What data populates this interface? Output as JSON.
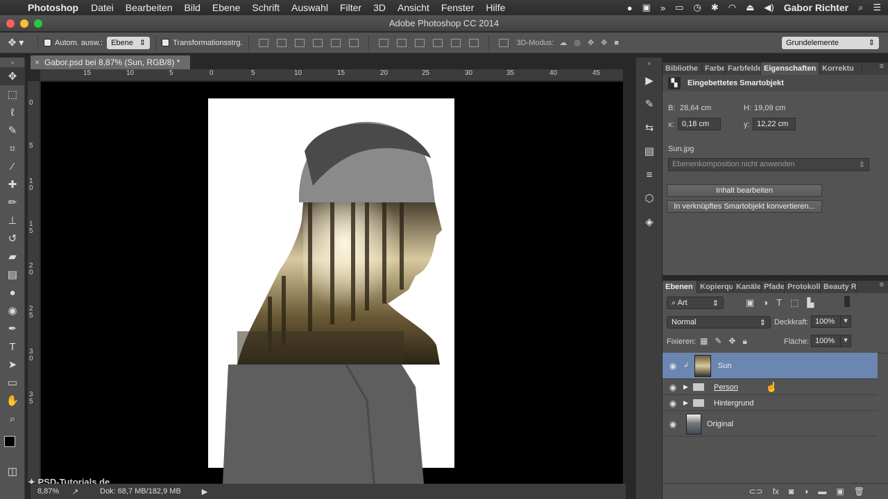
{
  "menubar": {
    "app": "Photoshop",
    "items": [
      "Datei",
      "Bearbeiten",
      "Bild",
      "Ebene",
      "Schrift",
      "Auswahl",
      "Filter",
      "3D",
      "Ansicht",
      "Fenster",
      "Hilfe"
    ],
    "user": "Gabor Richter"
  },
  "window_title": "Adobe Photoshop CC 2014",
  "options": {
    "auto_select_label": "Autom. ausw.:",
    "auto_select_value": "Ebene",
    "transform_label": "Transformationsstrg.",
    "mode_3d_label": "3D-Modus:",
    "workspace": "Grundelemente"
  },
  "doc_tab": "Gabor.psd bei 8,87% (Sun, RGB/8) *",
  "ruler": {
    "h_ticks": [
      "15",
      "10",
      "5",
      "0",
      "5",
      "10",
      "15",
      "20",
      "25",
      "30",
      "35",
      "40",
      "45"
    ],
    "v_ticks": [
      "0",
      "5",
      "1 0",
      "1 5",
      "2 0",
      "2 5",
      "3 0",
      "3 5"
    ]
  },
  "status": {
    "zoom": "8,87%",
    "doc": "Dok: 68,7 MB/182,9 MB"
  },
  "watermark": "PSD-Tutorials.de",
  "properties": {
    "tabs": [
      "Bibliothe",
      "Farbe",
      "Farbfelde",
      "Eigenschaften",
      "Korrektu"
    ],
    "header": "Eingebettetes Smartobjekt",
    "w_label": "B:",
    "w_value": "28,64 cm",
    "h_label": "H:",
    "h_value": "19,09 cm",
    "x_label": "x:",
    "x_value": "0,18 cm",
    "y_label": "y:",
    "y_value": "12,22 cm",
    "file": "Sun.jpg",
    "comp": "Ebenenkomposition nicht anwenden",
    "btn_edit": "Inhalt bearbeiten",
    "btn_convert": "In verknüpftes Smartobjekt konvertieren..."
  },
  "layers": {
    "tabs": [
      "Ebenen",
      "Kopierqu",
      "Kanäle",
      "Pfade",
      "Protokoll",
      "Beauty R"
    ],
    "filter": "Art",
    "blend": "Normal",
    "opacity_label": "Deckkraft:",
    "opacity": "100%",
    "lock_label": "Fixieren:",
    "fill_label": "Fläche:",
    "fill": "100%",
    "items": [
      {
        "name": "Sun"
      },
      {
        "name": "Person"
      },
      {
        "name": "Hintergrund"
      },
      {
        "name": "Original"
      }
    ]
  }
}
